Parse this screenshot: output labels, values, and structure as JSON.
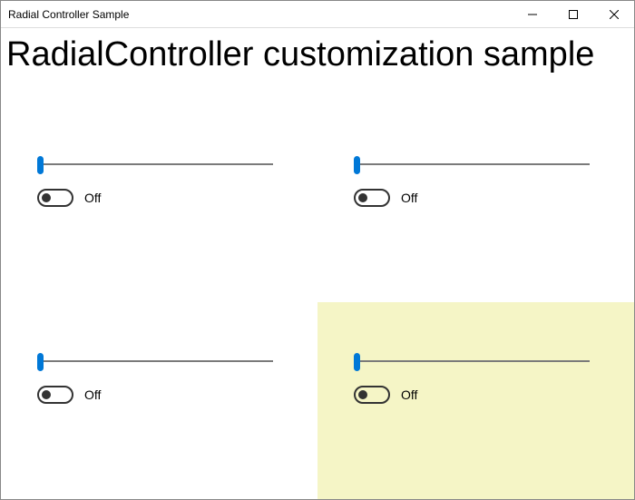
{
  "window": {
    "title": "Radial Controller Sample"
  },
  "heading": "RadialController customization sample",
  "quadrants": [
    {
      "slider_value": 0,
      "toggle_state": "off",
      "toggle_label": "Off",
      "highlight": false
    },
    {
      "slider_value": 0,
      "toggle_state": "off",
      "toggle_label": "Off",
      "highlight": false
    },
    {
      "slider_value": 0,
      "toggle_state": "off",
      "toggle_label": "Off",
      "highlight": false
    },
    {
      "slider_value": 0,
      "toggle_state": "off",
      "toggle_label": "Off",
      "highlight": true
    }
  ],
  "icons": {
    "minimize": "minimize-icon",
    "maximize": "maximize-icon",
    "close": "close-icon"
  }
}
